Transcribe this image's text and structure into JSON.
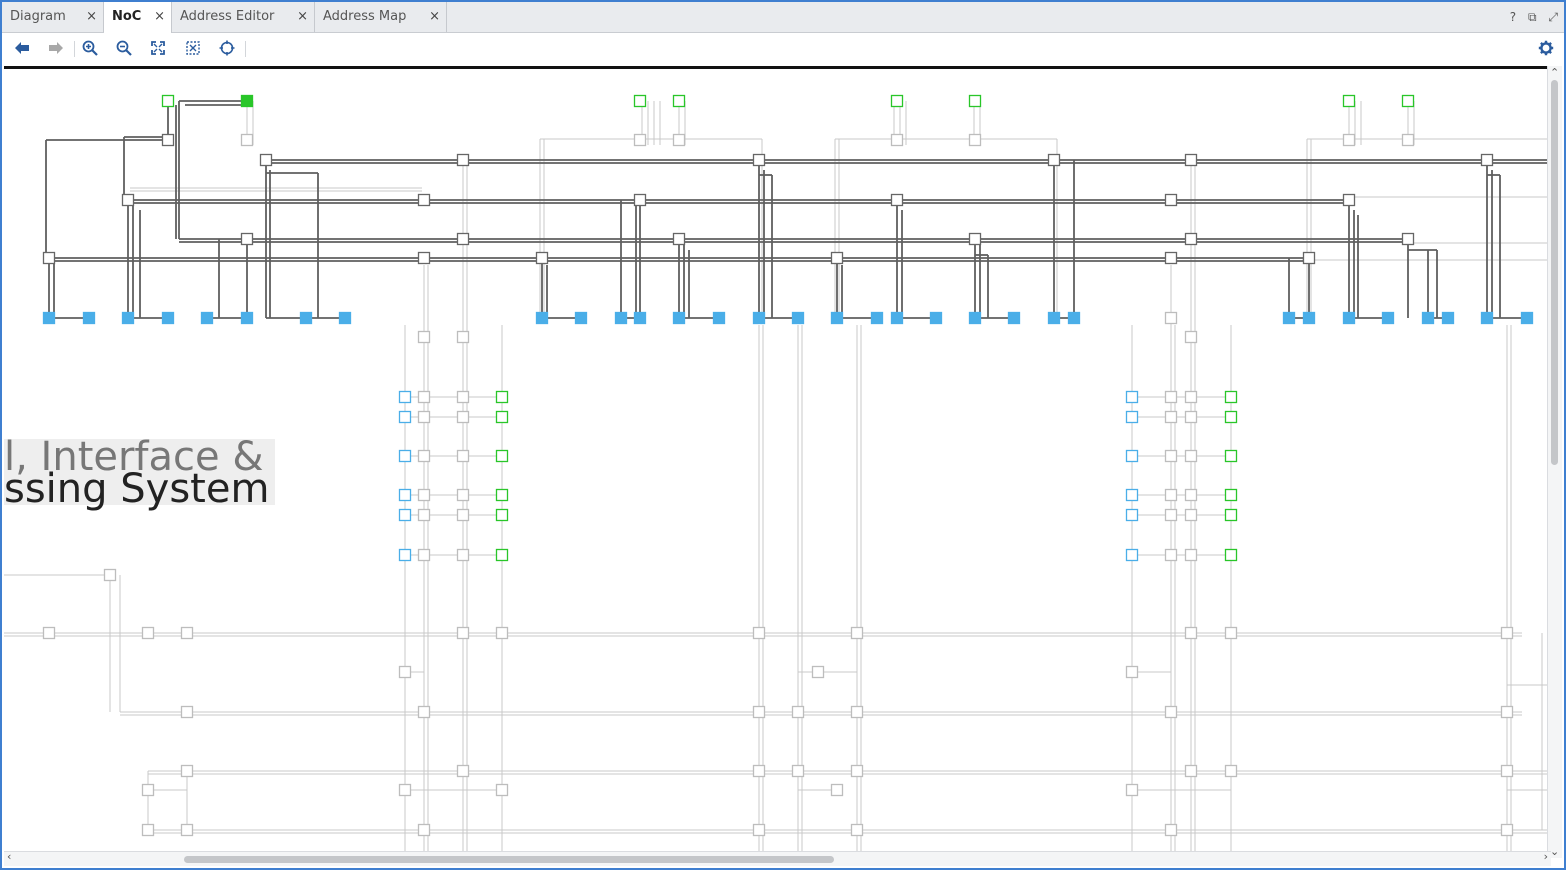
{
  "tabs": [
    {
      "label": "Diagram",
      "active": false
    },
    {
      "label": "NoC",
      "active": true
    },
    {
      "label": "Address Editor",
      "active": false
    },
    {
      "label": "Address Map",
      "active": false
    }
  ],
  "tab_close_glyph": "×",
  "window_controls": {
    "help": "?",
    "restore": "⧉",
    "maximize": "⤢"
  },
  "toolbar": [
    {
      "name": "back-arrow-icon"
    },
    {
      "name": "forward-arrow-icon"
    },
    {
      "name": "zoom-in-icon"
    },
    {
      "name": "zoom-out-icon"
    },
    {
      "name": "zoom-fit-icon"
    },
    {
      "name": "zoom-area-icon"
    },
    {
      "name": "recenter-icon"
    }
  ],
  "settings_icon": "gear-icon",
  "canvas": {
    "section_title_line1": "l, Interface &",
    "section_title_line2": "ssing System"
  },
  "colors": {
    "frame": "#3f7fd0",
    "noc_path_active": "#5f5f5f",
    "noc_path_inactive": "#c8c8c8",
    "master_port": "#4aaee8",
    "slave_port": "#29c629",
    "node_border": "#666666"
  }
}
